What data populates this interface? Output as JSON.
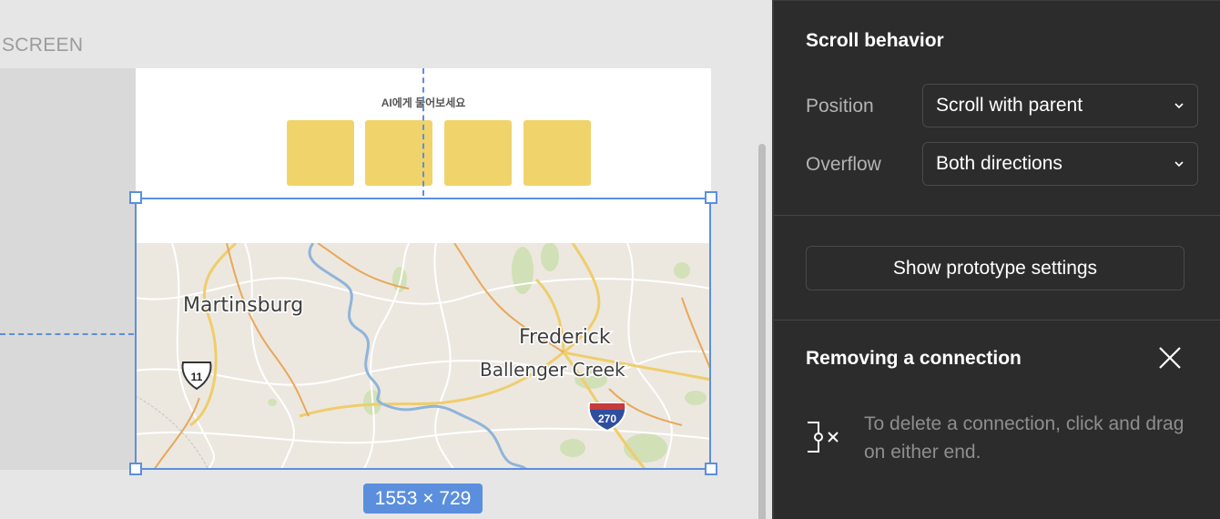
{
  "canvas": {
    "screen_label": "SCREEN",
    "frame_heading": "AI에게 물어보세요",
    "dimension_badge": "1553 × 729",
    "map": {
      "places": [
        "Martinsburg",
        "Frederick",
        "Ballenger Creek"
      ],
      "shields": [
        "11",
        "270"
      ]
    },
    "colors": {
      "selection": "#5b8fde",
      "tile": "#f1d36b",
      "map_background": "#ece8e0"
    }
  },
  "panel": {
    "scroll_behavior": {
      "title": "Scroll behavior",
      "position_label": "Position",
      "position_value": "Scroll with parent",
      "overflow_label": "Overflow",
      "overflow_value": "Both directions"
    },
    "prototype_button": "Show prototype settings",
    "removing": {
      "title": "Removing a connection",
      "help": "To delete a connection, click and drag on either end."
    },
    "icons": {
      "dropdown": "chevron-down-icon",
      "close": "close-icon",
      "connection": "disconnect-connection-icon"
    },
    "colors": {
      "background": "#2c2c2c",
      "text": "#ffffff",
      "muted": "#8e8e8e"
    }
  }
}
